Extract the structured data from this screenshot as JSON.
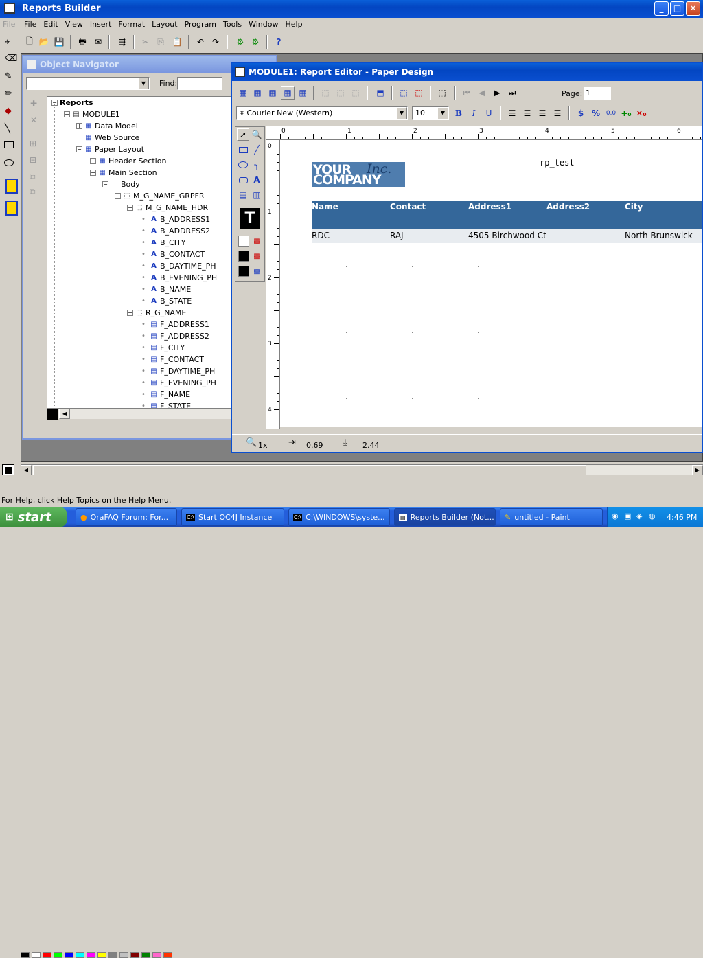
{
  "app": {
    "title": "Reports Builder"
  },
  "menu": [
    "File",
    "Edit",
    "View",
    "Insert",
    "Format",
    "Layout",
    "Program",
    "Tools",
    "Window",
    "Help"
  ],
  "left_file_label": "File",
  "navigator": {
    "title": "Object Navigator",
    "find_label": "Find:",
    "tree": [
      {
        "label": "Reports",
        "level": 0
      },
      {
        "label": "MODULE1",
        "level": 1
      },
      {
        "label": "Data Model",
        "level": 2
      },
      {
        "label": "Web Source",
        "level": 2
      },
      {
        "label": "Paper Layout",
        "level": 2
      },
      {
        "label": "Header Section",
        "level": 3
      },
      {
        "label": "Main Section",
        "level": 3
      },
      {
        "label": "Body",
        "level": 4
      },
      {
        "label": "M_G_NAME_GRPFR",
        "level": 5
      },
      {
        "label": "M_G_NAME_HDR",
        "level": 6
      },
      {
        "label": "B_ADDRESS1",
        "level": 7
      },
      {
        "label": "B_ADDRESS2",
        "level": 7
      },
      {
        "label": "B_CITY",
        "level": 7
      },
      {
        "label": "B_CONTACT",
        "level": 7
      },
      {
        "label": "B_DAYTIME_PH",
        "level": 7
      },
      {
        "label": "B_EVENING_PH",
        "level": 7
      },
      {
        "label": "B_NAME",
        "level": 7
      },
      {
        "label": "B_STATE",
        "level": 7
      },
      {
        "label": "R_G_NAME",
        "level": 6
      },
      {
        "label": "F_ADDRESS1",
        "level": 7
      },
      {
        "label": "F_ADDRESS2",
        "level": 7
      },
      {
        "label": "F_CITY",
        "level": 7
      },
      {
        "label": "F_CONTACT",
        "level": 7
      },
      {
        "label": "F_DAYTIME_PH",
        "level": 7
      },
      {
        "label": "F_EVENING_PH",
        "level": 7
      },
      {
        "label": "F_NAME",
        "level": 7
      },
      {
        "label": "F_STATE",
        "level": 7
      }
    ]
  },
  "editor": {
    "title": "MODULE1: Report Editor - Paper Design",
    "page_label": "Page:",
    "page_value": "1",
    "font_value": "Courier New (Western)",
    "size_value": "10",
    "ruler_h": [
      "0",
      "1",
      "2",
      "3",
      "4",
      "5",
      "6"
    ],
    "ruler_v": [
      "0",
      "1",
      "2",
      "3",
      "4"
    ],
    "status": {
      "zoom": "1x",
      "x": "0.69",
      "y": "2.44"
    },
    "report": {
      "logo_line1": "YOUR",
      "logo_inc": "Inc.",
      "logo_line2": "COMPANY",
      "report_title": "rp_test",
      "headers": [
        "Name",
        "Contact",
        "Address1",
        "Address2",
        "City"
      ],
      "row": [
        "RDC",
        "RAJ",
        "4505 Birchwood Ct",
        "",
        "North Brunswick"
      ]
    }
  },
  "statusbar": "For Help, click Help Topics on the Help Menu.",
  "taskbar": {
    "start": "start",
    "items": [
      "OraFAQ Forum: For...",
      "Start OC4J Instance",
      "C:\\WINDOWS\\syste...",
      "Reports Builder (Not...",
      "untitled - Paint"
    ],
    "clock": "4:46 PM"
  },
  "colors": {
    "header_blue": "#34679a",
    "logo_blue": "#4f7dae",
    "row_bg": "#e8ecf0"
  }
}
